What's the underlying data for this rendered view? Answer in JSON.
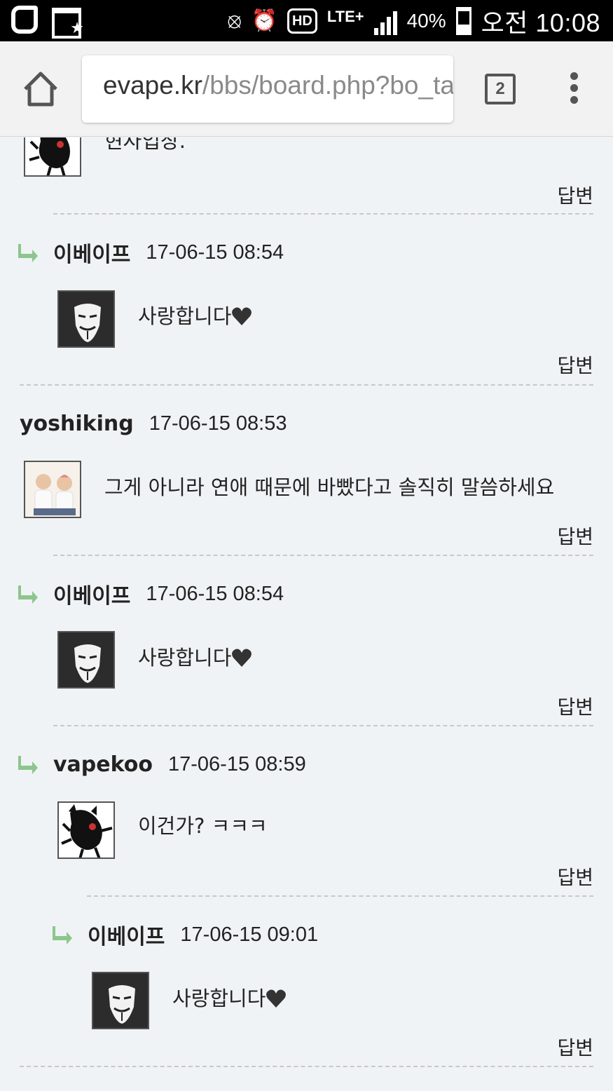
{
  "status_bar": {
    "battery": "40%",
    "network": "LTE+",
    "hd_badge": "HD",
    "time": "오전 10:08"
  },
  "browser": {
    "url_host": "evape.kr",
    "url_path": "/bbs/board.php?bo_table",
    "tab_count": "2"
  },
  "comments": [
    {
      "partial_text": "현자입장.",
      "reply_label": "답변"
    },
    {
      "nick": "이베이프",
      "date": "17-06-15 08:54",
      "text": "사랑합니다",
      "reply_label": "답변"
    },
    {
      "nick": "yoshiking",
      "date": "17-06-15 08:53",
      "text": "그게 아니라 연애 때문에 바빴다고 솔직히 말씀하세요",
      "reply_label": "답변"
    },
    {
      "nick": "이베이프",
      "date": "17-06-15 08:54",
      "text": "사랑합니다",
      "reply_label": "답변"
    },
    {
      "nick": "vapekoo",
      "date": "17-06-15 08:59",
      "text": "이건가? ㅋㅋㅋ",
      "reply_label": "답변"
    },
    {
      "nick": "이베이프",
      "date": "17-06-15 09:01",
      "text": "사랑합니다",
      "reply_label": "답변"
    }
  ],
  "colors": {
    "page_bg": "#f0f3f5",
    "reply_arrow": "#7fbf7f",
    "heart": "#333333"
  }
}
